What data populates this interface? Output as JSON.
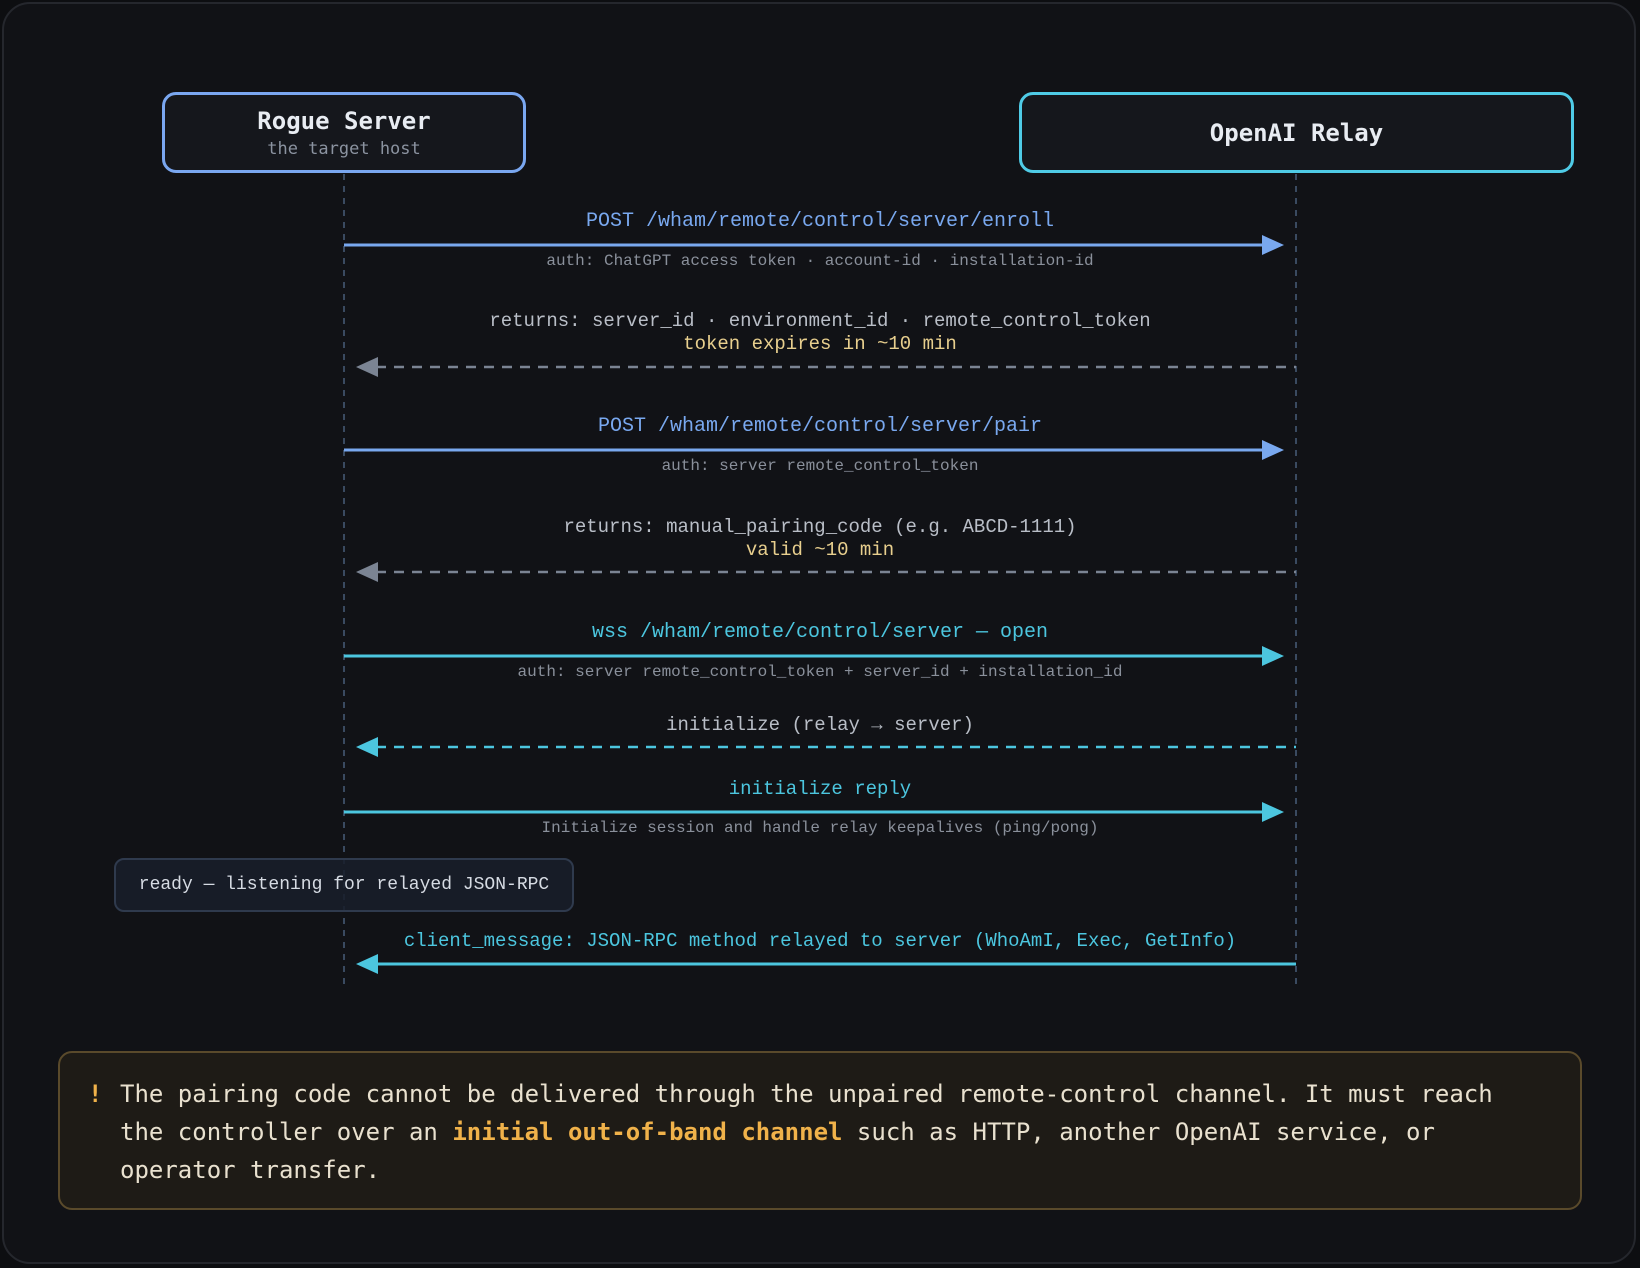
{
  "participants": {
    "rogue": {
      "title": "Rogue Server",
      "subtitle": "the target host"
    },
    "relay": {
      "title": "OpenAI Relay"
    }
  },
  "messages": [
    {
      "label": "POST /wham/remote/control/server/enroll",
      "note": "auth: ChatGPT access token · account-id · installation-id",
      "direction": "to-relay",
      "style": "solid"
    },
    {
      "label": "returns: server_id · environment_id · remote_control_token",
      "note": "token expires in ~10 min",
      "direction": "to-server",
      "style": "dashed"
    },
    {
      "label": "POST /wham/remote/control/server/pair",
      "note": "auth: server remote_control_token",
      "direction": "to-relay",
      "style": "solid"
    },
    {
      "label": "returns: manual_pairing_code (e.g. ABCD-1111)",
      "note": "valid ~10 min",
      "direction": "to-server",
      "style": "dashed"
    },
    {
      "label": "wss /wham/remote/control/server — open",
      "note": "auth: server remote_control_token + server_id + installation_id",
      "direction": "to-relay",
      "style": "solid"
    },
    {
      "label": "initialize (relay → server)",
      "direction": "to-server",
      "style": "dashed"
    },
    {
      "label": "initialize reply",
      "note": "Initialize session and handle relay keepalives (ping/pong)",
      "direction": "to-relay",
      "style": "solid"
    },
    {
      "label": "client_message: JSON-RPC method relayed to server (WhoAmI, Exec, GetInfo)",
      "direction": "to-server",
      "style": "solid"
    }
  ],
  "ready_note": "ready — listening for relayed JSON-RPC",
  "warning": {
    "icon": "!",
    "text_before": "The pairing code cannot be delivered through the unpaired remote-control channel. It must reach the controller over an ",
    "highlight": "initial out-of-band channel",
    "text_after": " such as HTTP, another OpenAI service, or operator transfer."
  },
  "colors": {
    "blue": "#79a8ef",
    "cyan": "#4cc6df",
    "gray_arrow": "#7b8493",
    "warning_accent": "#f0b24a"
  }
}
